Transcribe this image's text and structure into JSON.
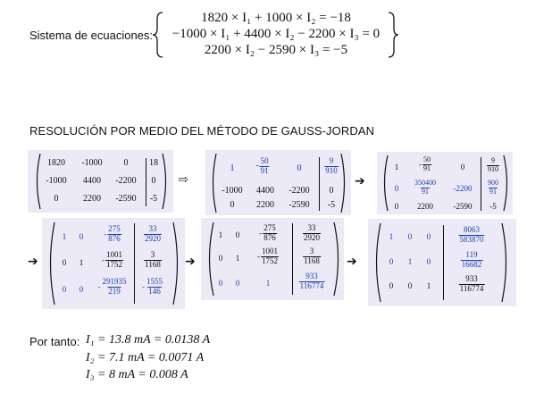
{
  "system": {
    "label": "Sistema de ecuaciones:",
    "eq1": "1820 × I₁ + 1000 × I₂ = −18",
    "eq2": "−1000 × I₁ + 4400 × I₂ − 2200 × I₃ = 0",
    "eq3": "2200 × I₂ − 2590 × I₃ = −5"
  },
  "heading": "RESOLUCIÓN POR MEDIO DEL MÉTODO DE GAUSS-JORDAN",
  "arrows": {
    "hollow": "⇨",
    "solid": "➔"
  },
  "m1": {
    "r1": [
      "1820",
      "-1000",
      "0",
      "18"
    ],
    "r2": [
      "-1000",
      "4400",
      "-2200",
      "0"
    ],
    "r3": [
      "0",
      "2200",
      "-2590",
      "-5"
    ]
  },
  "m2": {
    "r1": [
      "1",
      "-",
      "50",
      "91",
      "0",
      "9",
      "910"
    ],
    "r2": [
      "-1000",
      "4400",
      "-2200",
      "0"
    ],
    "r3": [
      "0",
      "2200",
      "-2590",
      "-5"
    ]
  },
  "m3": {
    "r1": [
      "1",
      "-",
      "50",
      "91",
      "0",
      "9",
      "910"
    ],
    "r2": [
      "0",
      "350400",
      "91",
      "-2200",
      "900",
      "91"
    ],
    "r3": [
      "0",
      "2200",
      "-2590",
      "-5"
    ]
  },
  "m4": {
    "r1": [
      "1",
      "0",
      "-",
      "275",
      "876",
      "33",
      "2920"
    ],
    "r2": [
      "0",
      "1",
      "-",
      "1001",
      "1752",
      "3",
      "1168"
    ],
    "r3": [
      "0",
      "0",
      "-",
      "291935",
      "219",
      "-",
      "1555",
      "146"
    ]
  },
  "m5": {
    "r1": [
      "1",
      "0",
      "-",
      "275",
      "876",
      "33",
      "2920"
    ],
    "r2": [
      "0",
      "1",
      "-",
      "1001",
      "1752",
      "3",
      "1168"
    ],
    "r3": [
      "0",
      "0",
      "1",
      "933",
      "116774"
    ]
  },
  "m6": {
    "r1": [
      "1",
      "0",
      "0",
      "8063",
      "583870"
    ],
    "r2": [
      "0",
      "1",
      "0",
      "119",
      "16682"
    ],
    "r3": [
      "0",
      "0",
      "1",
      "933",
      "116774"
    ]
  },
  "result": {
    "label": "Por tanto:",
    "l1": "I₁ = 13.8 mA = 0.0138 A",
    "l2": "I₂ = 7.1 mA = 0.0071 A",
    "l3": "I₃ = 8 mA = 0.008 A"
  },
  "colors": {
    "highlight_box": "#eceaf7",
    "accent_blue": "#1b40b0"
  }
}
